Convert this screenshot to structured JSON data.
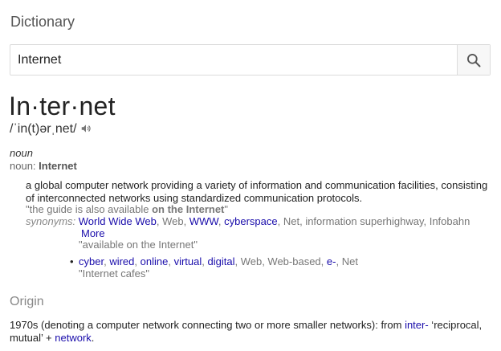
{
  "panel": {
    "title": "Dictionary"
  },
  "search": {
    "value": "Internet",
    "button_icon": "search-icon"
  },
  "entry": {
    "headword": "In·ter·net",
    "phonetic": "/ˈin(t)ərˌnet/",
    "audio_icon": "speaker-icon",
    "pos": "noun",
    "pos_prefix": "noun:",
    "pos_word": "Internet",
    "definition": "a global computer network providing a variety of information and communication facilities, consisting of interconnected networks using standardized communication protocols.",
    "example": {
      "before": "\"the guide is also available ",
      "bold": "on the Internet",
      "after": "\""
    },
    "synonyms_label": "synonyms:",
    "synonyms_1": [
      {
        "text": "World Wide Web",
        "link": true
      },
      {
        "text": "Web",
        "link": false
      },
      {
        "text": "WWW",
        "link": true
      },
      {
        "text": "cyberspace",
        "link": true
      },
      {
        "text": "Net",
        "link": false
      },
      {
        "text": "information superhighway",
        "link": false
      },
      {
        "text": "Infobahn",
        "link": false
      }
    ],
    "more_label": "More",
    "example_2": "\"available on the Internet\"",
    "synonyms_2": [
      {
        "text": "cyber",
        "link": true
      },
      {
        "text": "wired",
        "link": true
      },
      {
        "text": "online",
        "link": true
      },
      {
        "text": "virtual",
        "link": true
      },
      {
        "text": "digital",
        "link": true
      },
      {
        "text": "Web",
        "link": false
      },
      {
        "text": "Web-based",
        "link": false
      },
      {
        "text": "e-",
        "link": true
      },
      {
        "text": "Net",
        "link": false
      }
    ],
    "example_3": "\"Internet cafes\""
  },
  "origin": {
    "heading": "Origin",
    "text_1": "1970s (denoting a computer network connecting two or more smaller networks): from ",
    "link_1": "inter-",
    "text_2": " ‘reciprocal, mutual’ + ",
    "link_2": "network",
    "text_3": "."
  },
  "colors": {
    "link": "#1a0dab",
    "muted": "#777777",
    "text": "#222222"
  }
}
